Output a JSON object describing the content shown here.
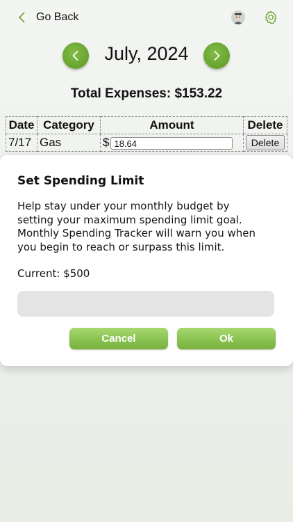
{
  "header": {
    "back_label": "Go Back",
    "avatar_icon": "user-avatar-icon",
    "settings_icon": "gear-icon"
  },
  "month": {
    "title": "July, 2024",
    "prev_icon": "chevron-left-icon",
    "next_icon": "chevron-right-icon"
  },
  "summary": {
    "total_label": "Total Expenses: $153.22"
  },
  "table": {
    "headers": [
      "Date",
      "Category",
      "Amount",
      "Delete"
    ],
    "rows": [
      {
        "date": "7/17",
        "category": "Gas",
        "currency": "$",
        "amount": "18.64",
        "delete_label": "Delete"
      }
    ]
  },
  "dialog": {
    "title": "Set Spending Limit",
    "message": "Help stay under your monthly budget by setting your maximum spending limit goal. Monthly Spending Tracker will warn you when you begin to reach or surpass this limit.",
    "current": "Current: $500",
    "input_value": "",
    "cancel_label": "Cancel",
    "ok_label": "Ok"
  },
  "colors": {
    "accent_green": "#6aa42f",
    "button_green": "#8cc453",
    "background": "#eef1ec"
  }
}
